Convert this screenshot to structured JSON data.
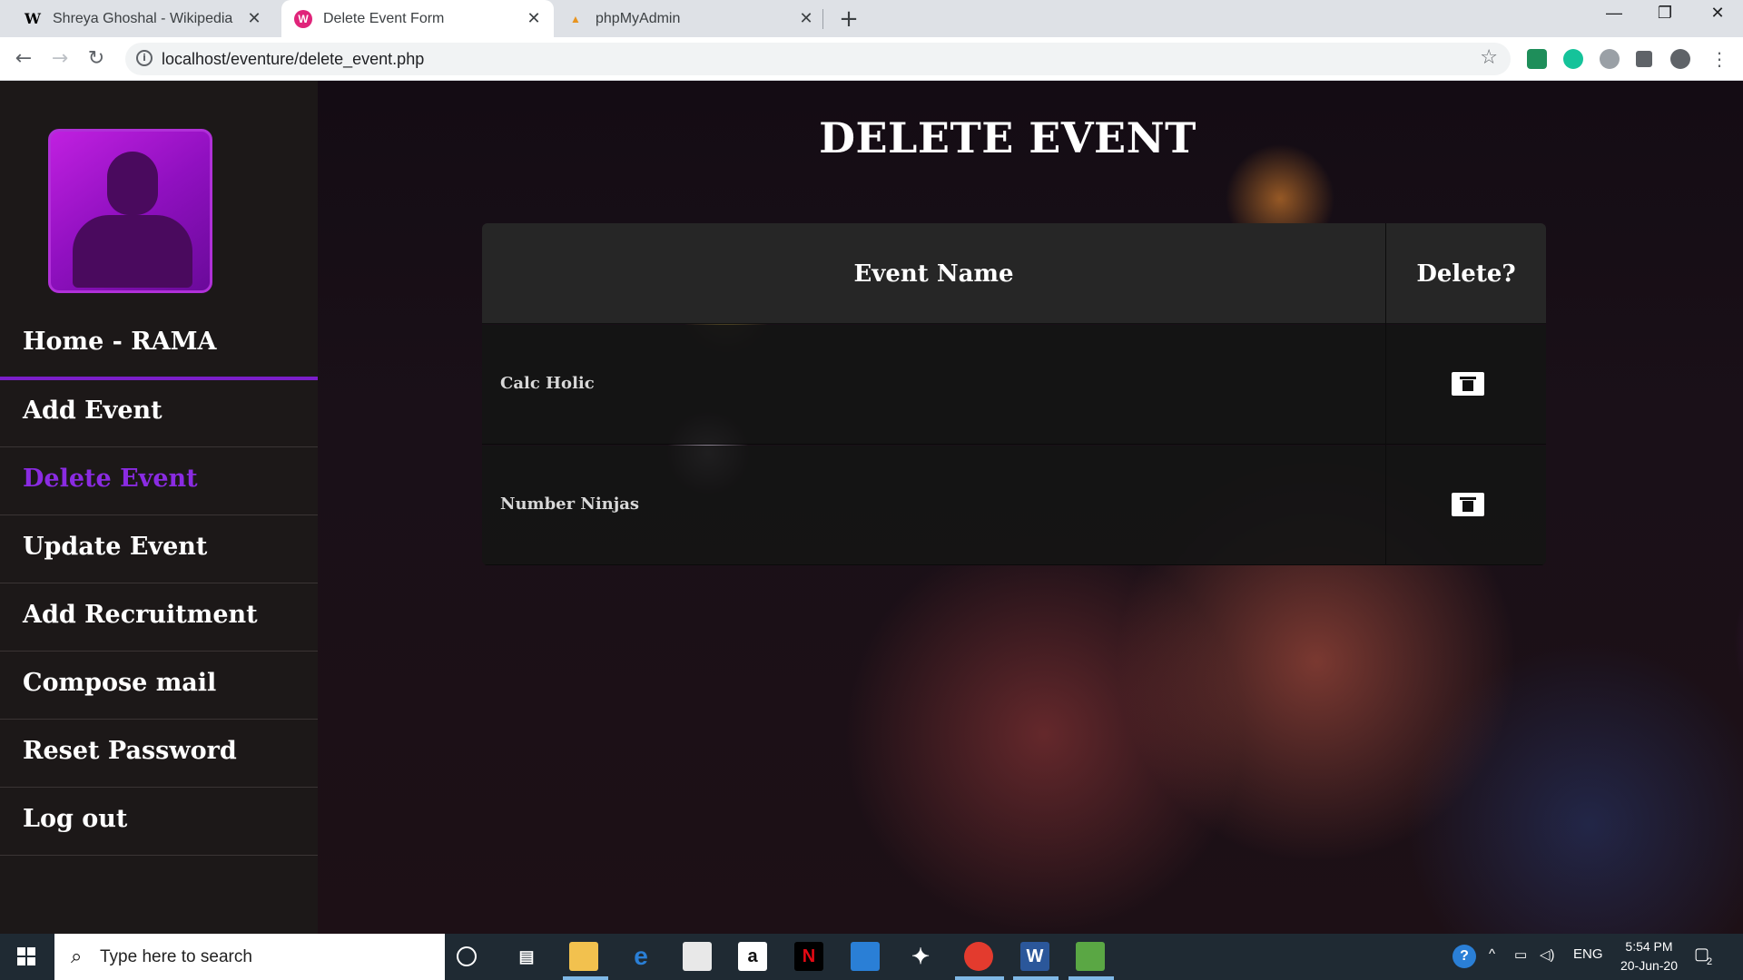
{
  "browser": {
    "tabs": [
      {
        "label": "Shreya Ghoshal - Wikipedia",
        "favicon": "W"
      },
      {
        "label": "Delete Event Form",
        "favicon": "W"
      },
      {
        "label": "phpMyAdmin",
        "favicon": "pma"
      }
    ],
    "url": "localhost/eventure/delete_event.php"
  },
  "sidebar": {
    "items": [
      {
        "label": "Home - RAMA"
      },
      {
        "label": "Add Event"
      },
      {
        "label": "Delete Event"
      },
      {
        "label": "Update Event"
      },
      {
        "label": "Add Recruitment"
      },
      {
        "label": "Compose mail"
      },
      {
        "label": "Reset Password"
      },
      {
        "label": "Log out"
      }
    ],
    "active_color": "#8a2be2"
  },
  "main": {
    "title": "DELETE EVENT",
    "table": {
      "headers": [
        "Event Name",
        "Delete?"
      ],
      "rows": [
        {
          "name": "Calc Holic"
        },
        {
          "name": "Number Ninjas"
        }
      ]
    }
  },
  "taskbar": {
    "search_placeholder": "Type here to search",
    "language": "ENG",
    "time": "5:54 PM",
    "date": "20-Jun-20",
    "notification_count": "2"
  }
}
